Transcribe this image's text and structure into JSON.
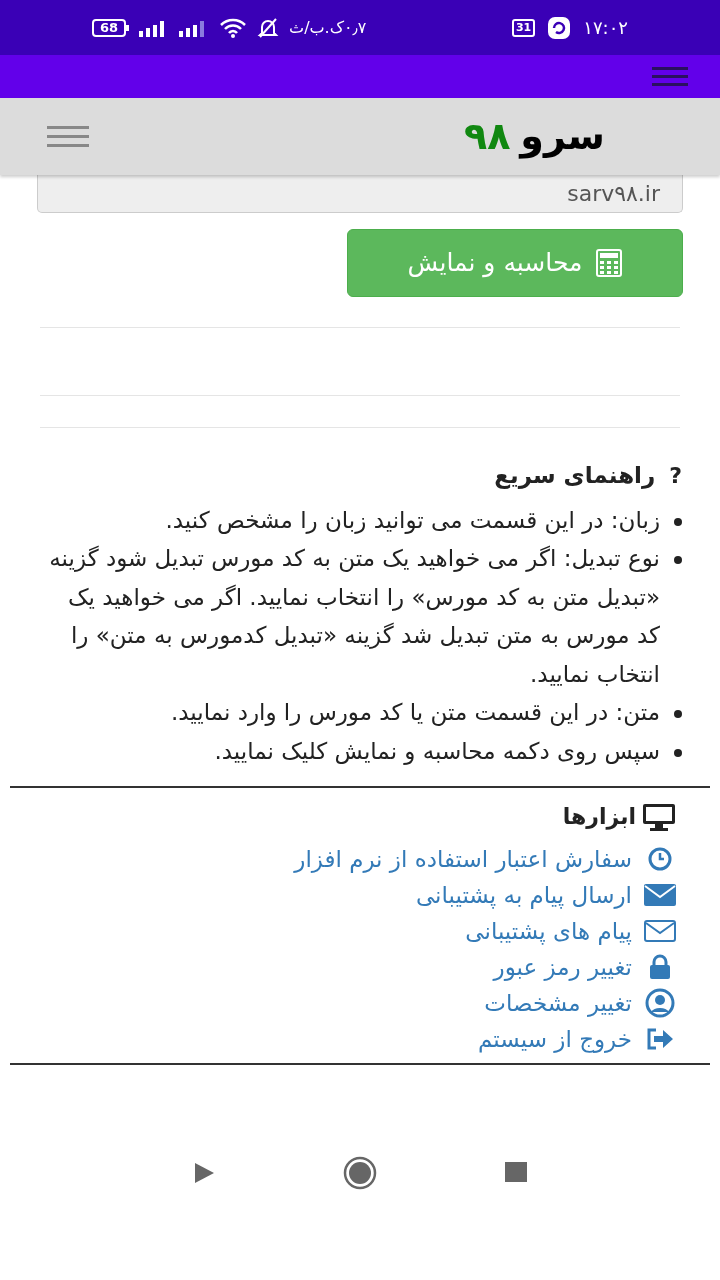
{
  "status_bar": {
    "time": "۱۷:۰۲",
    "calendar": "31",
    "speed": "۰٫۷ک.ب/ث",
    "battery": "68"
  },
  "site_header": {
    "logo_word": "سرو",
    "logo_number": "۹۸"
  },
  "url_field": {
    "value": "sarv۹۸.ir"
  },
  "calculate_button": {
    "label": "محاسبه و نمایش"
  },
  "help": {
    "title": "راهنمای سریع",
    "icon_text": "?",
    "items": [
      "زبان: در این قسمت می توانید زبان را مشخص کنید.",
      "نوع تبدیل: اگر می خواهید یک متن به کد مورس تبدیل شود گزینه «تبدیل متن به کد مورس» را انتخاب نمایید. اگر می خواهید یک کد مورس به متن تبدیل شد گزینه «تبدیل کدمورس به متن» را انتخاب نمایید.",
      "متن: در این قسمت متن یا کد مورس را وارد نمایید.",
      "سپس روی دکمه محاسبه و نمایش کلیک نمایید."
    ]
  },
  "tools": {
    "title": "ابزارها",
    "links": [
      {
        "kind": "clock",
        "label": "سفارش اعتبار استفاده از نرم افزار"
      },
      {
        "kind": "envelope",
        "label": "ارسال پیام به پشتیبانی"
      },
      {
        "kind": "envelope-outline",
        "label": "پیام های پشتیبانی"
      },
      {
        "kind": "lock",
        "label": "تغییر رمز عبور"
      },
      {
        "kind": "user",
        "label": "تغییر مشخصات"
      },
      {
        "kind": "exit",
        "label": "خروج از سیستم"
      }
    ]
  }
}
